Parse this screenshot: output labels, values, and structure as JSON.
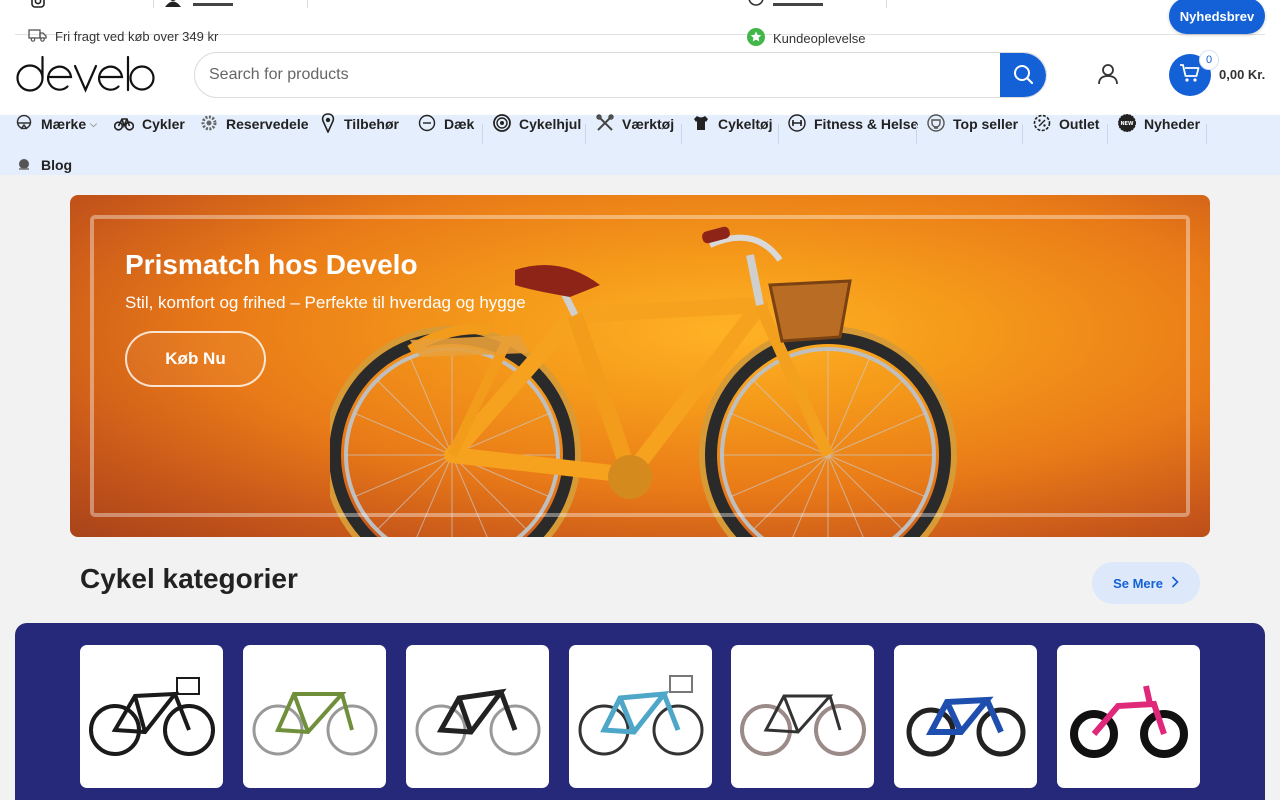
{
  "topbar": {
    "shipping_text": "Fri fragt ved køb over 349 kr",
    "experience_text": "Kundeoplevelse",
    "newsletter_label": "Nyhedsbrev"
  },
  "header": {
    "logo_text": "develo",
    "search_placeholder": "Search for products",
    "cart_count": "0",
    "cart_total": "0,00 Kr."
  },
  "nav": {
    "items": [
      {
        "label": "Mærke",
        "icon": "helmet-icon"
      },
      {
        "label": "Cykler",
        "icon": "bicycle-icon"
      },
      {
        "label": "Reservedele",
        "icon": "gear-part-icon"
      },
      {
        "label": "Tilbehør",
        "icon": "location-pin-icon"
      },
      {
        "label": "Dæk",
        "icon": "tire-icon"
      },
      {
        "label": "Cykelhjul",
        "icon": "wheel-icon"
      },
      {
        "label": "Værktøj",
        "icon": "tools-icon"
      },
      {
        "label": "Cykeltøj",
        "icon": "jersey-icon"
      },
      {
        "label": "Fitness & Helse",
        "icon": "dumbbell-icon"
      },
      {
        "label": "Top seller",
        "icon": "trophy-icon"
      },
      {
        "label": "Outlet",
        "icon": "discount-icon"
      },
      {
        "label": "Nyheder",
        "icon": "new-badge-icon"
      },
      {
        "label": "Blog",
        "icon": "blog-icon"
      }
    ]
  },
  "hero": {
    "title": "Prismatch hos Develo",
    "subtitle": "Stil, komfort og frihed – Perfekte til hverdag og hygge",
    "cta_label": "Køb Nu"
  },
  "categories": {
    "title": "Cykel kategorier",
    "see_more_label": "Se Mere",
    "colors": [
      "#1a1a1a",
      "#6f8f3a",
      "#222222",
      "#4ea7c9",
      "#333333",
      "#1f4fae",
      "#e0287a"
    ]
  },
  "colors": {
    "brand_blue": "#1460d6",
    "nav_bg": "#e5eefc",
    "category_panel": "#26297a"
  }
}
